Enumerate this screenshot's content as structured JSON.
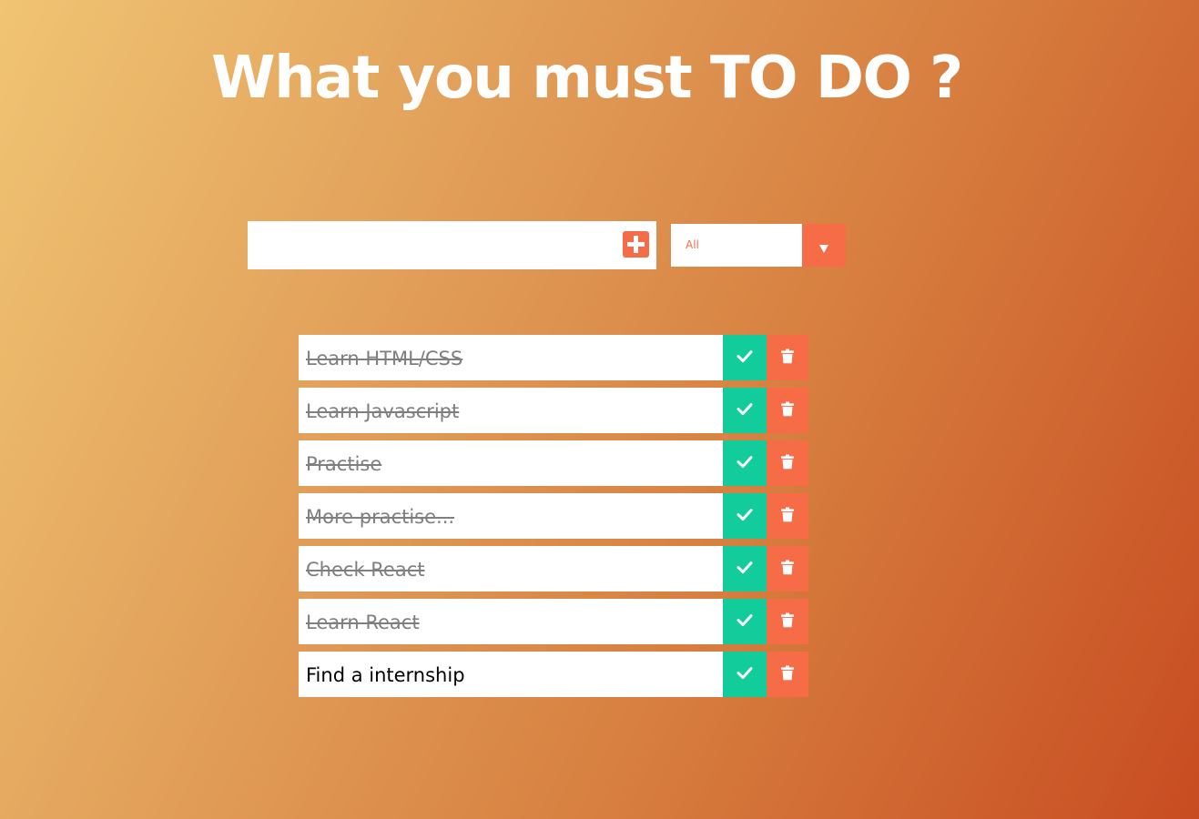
{
  "header": {
    "title": "What you must TO DO ?"
  },
  "input": {
    "value": "",
    "placeholder": "",
    "add_icon": "plus-square-icon"
  },
  "filter": {
    "selected": "All",
    "dropdown_icon": "caret-down-icon"
  },
  "todos": [
    {
      "text": "Learn HTML/CSS",
      "completed": true
    },
    {
      "text": "Learn Javascript",
      "completed": true
    },
    {
      "text": "Practise",
      "completed": true
    },
    {
      "text": "More practise...",
      "completed": true
    },
    {
      "text": "Check React",
      "completed": true
    },
    {
      "text": "Learn React",
      "completed": true
    },
    {
      "text": "Find a internship",
      "completed": false
    }
  ],
  "item_icons": {
    "complete": "check-icon",
    "delete": "trash-icon"
  },
  "colors": {
    "accent": "#f56c46",
    "complete": "#12cc9b",
    "completed_text": "#7f7f7f",
    "background_start": "#f0c473",
    "background_end": "#c84c21"
  }
}
